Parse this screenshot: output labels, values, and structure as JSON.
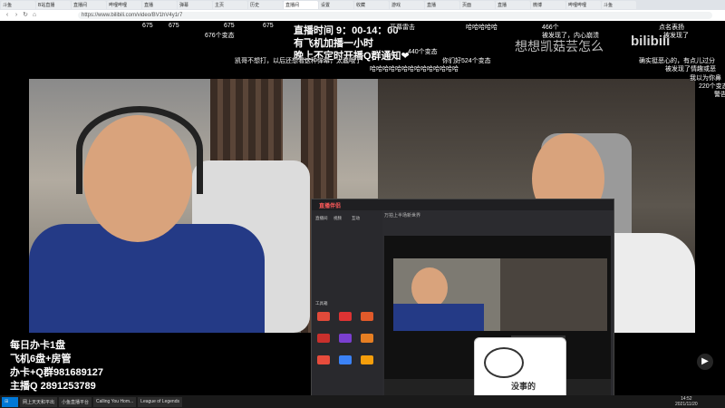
{
  "browser": {
    "tabs": [
      "斗鱼",
      "B站直播",
      "直播间",
      "哔哩哔哩",
      "直播",
      "弹幕",
      "主页",
      "历史",
      "直播间",
      "设置",
      "收藏",
      "游戏",
      "直播",
      "页面",
      "直播",
      "微博",
      "哔哩哔哩",
      "斗鱼"
    ],
    "active_tab_index": 8,
    "url": "https://www.bilibili.com/video/BV1hV4y1r7"
  },
  "stream_overlay": {
    "schedule_line1": "直播时间 9：00-14：00",
    "schedule_line2": "有飞机加播一小时",
    "schedule_line3": "晚上不定时开播Q群通知❤",
    "watermark": "想想凯菇芸怎么",
    "bili_logo": "bilibili"
  },
  "info_box": {
    "line1": "每日办卡1盘",
    "line2": "飞机6盘+房管",
    "line3": "办卡+Q群981689127",
    "line4": "主播Q 2891253789"
  },
  "danmaku": [
    "675",
    "675",
    "675",
    "675",
    "676个变态",
    "开幕雷击",
    "哈哈哈哈哈",
    "466个",
    "点名表扬",
    "被发现了，内心崩溃",
    "被发现了",
    "440个变态",
    "凯哥不想打，以后还想看这种弹幕，太蠢哦了",
    "你们好524个变态",
    "确实挺恶心的，有点儿过分",
    "哈哈哈哈哈哈哈哈哈哈哈哈哈哈",
    "被发现了情趣或恶",
    "220个变态",
    "我以为你鼻",
    "警告"
  ],
  "stream_software": {
    "brand": "直播伴侣",
    "side_menu": [
      "直播间",
      "视频",
      "互动",
      "工具箱"
    ],
    "tab_label": "万拍上半场新世界"
  },
  "cat_sticker": "没事的",
  "taskbar": {
    "items": [
      "网上天天和平出",
      "小鱼直播平台",
      "Calling You Hom...",
      "League of Legends"
    ],
    "time": "14:52",
    "date": "2021/11/20"
  },
  "colors": {
    "accent": "#ff5a5a",
    "bili_blue": "#00a1d6"
  }
}
